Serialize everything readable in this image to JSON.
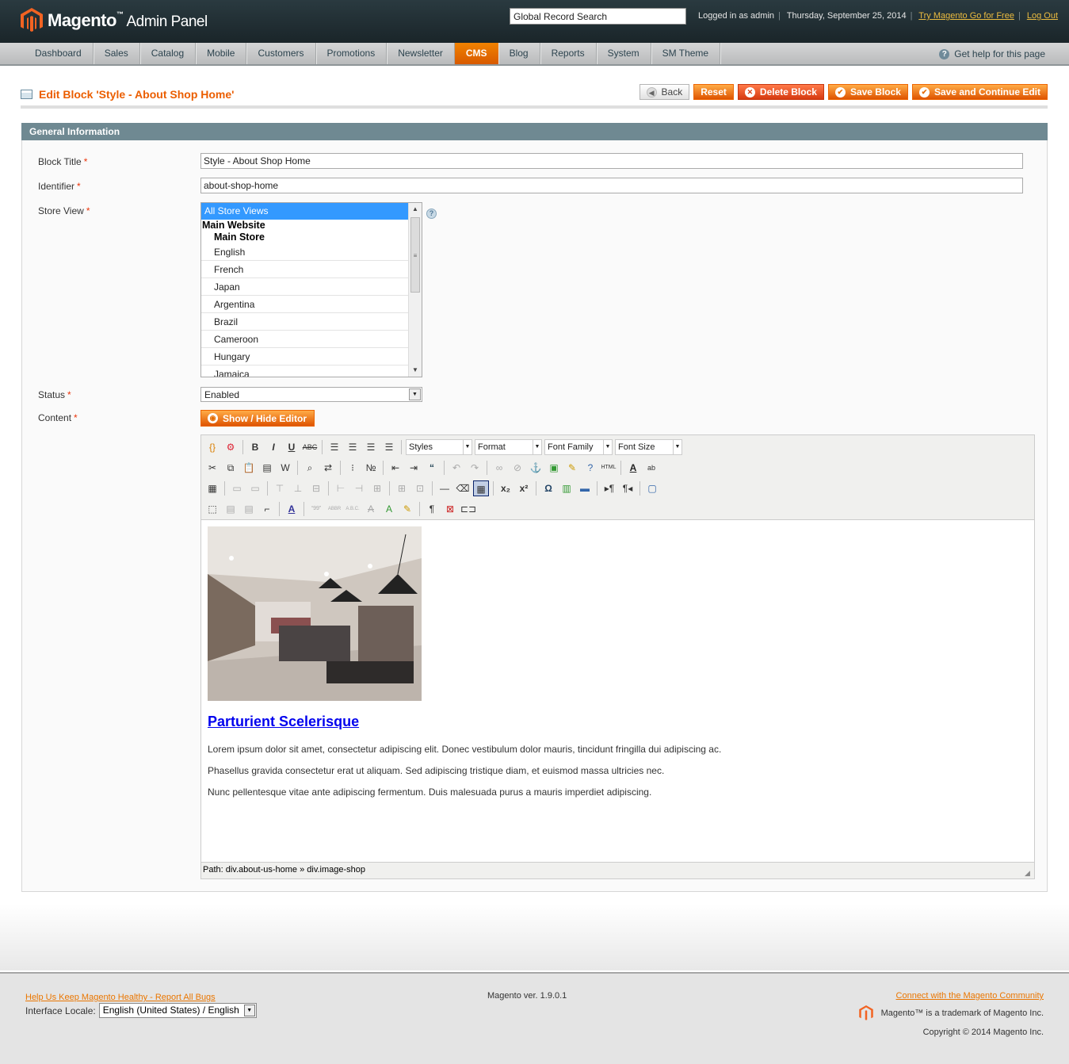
{
  "header": {
    "logo_name": "Magento",
    "logo_tm": "™",
    "logo_sub": "Admin Panel",
    "search_placeholder": "Global Record Search",
    "logged_in": "Logged in as admin",
    "date": "Thursday, September 25, 2014",
    "try_link": "Try Magento Go for Free",
    "logout": "Log Out"
  },
  "nav": {
    "items": [
      "Dashboard",
      "Sales",
      "Catalog",
      "Mobile",
      "Customers",
      "Promotions",
      "Newsletter",
      "CMS",
      "Blog",
      "Reports",
      "System",
      "SM Theme"
    ],
    "active": "CMS",
    "help": "Get help for this page"
  },
  "page": {
    "title": "Edit Block 'Style - About Shop Home'",
    "buttons": {
      "back": "Back",
      "reset": "Reset",
      "delete": "Delete Block",
      "save": "Save Block",
      "save_continue": "Save and Continue Edit"
    }
  },
  "form": {
    "section_title": "General Information",
    "block_title_label": "Block Title",
    "block_title_value": "Style - About Shop Home",
    "identifier_label": "Identifier",
    "identifier_value": "about-shop-home",
    "store_view_label": "Store View",
    "store_view": {
      "selected": "All Store Views",
      "website": "Main Website",
      "store": "Main Store",
      "views": [
        "English",
        "French",
        "Japan",
        "Argentina",
        "Brazil",
        "Cameroon",
        "Hungary",
        "Jamaica"
      ]
    },
    "status_label": "Status",
    "status_value": "Enabled",
    "content_label": "Content",
    "show_hide_editor": "Show / Hide Editor",
    "required_mark": "*"
  },
  "editor": {
    "styles": "Styles",
    "format": "Format",
    "font_family": "Font Family",
    "font_size": "Font Size",
    "heading": "Parturient Scelerisque",
    "paragraphs": [
      "Lorem ipsum dolor sit amet, consectetur adipiscing elit. Donec vestibulum dolor mauris, tincidunt fringilla dui adipiscing ac.",
      "Phasellus gravida consectetur erat ut aliquam. Sed adipiscing tristique diam, et euismod massa ultricies nec.",
      "Nunc pellentesque vitae ante adipiscing fermentum. Duis malesuada purus a mauris imperdiet adipiscing."
    ],
    "path": "Path: div.about-us-home » div.image-shop"
  },
  "footer": {
    "report_bugs": "Help Us Keep Magento Healthy - Report All Bugs",
    "locale_label": "Interface Locale:",
    "locale_value": "English (United States) / English",
    "version": "Magento ver. 1.9.0.1",
    "community": "Connect with the Magento Community",
    "trademark": "Magento™ is a trademark of Magento Inc.",
    "copyright": "Copyright © 2014 Magento Inc."
  },
  "colors": {
    "accent": "#eb5e00",
    "nav_active": "#e86b00",
    "section_head": "#6f8992",
    "link": "#0000ee"
  }
}
